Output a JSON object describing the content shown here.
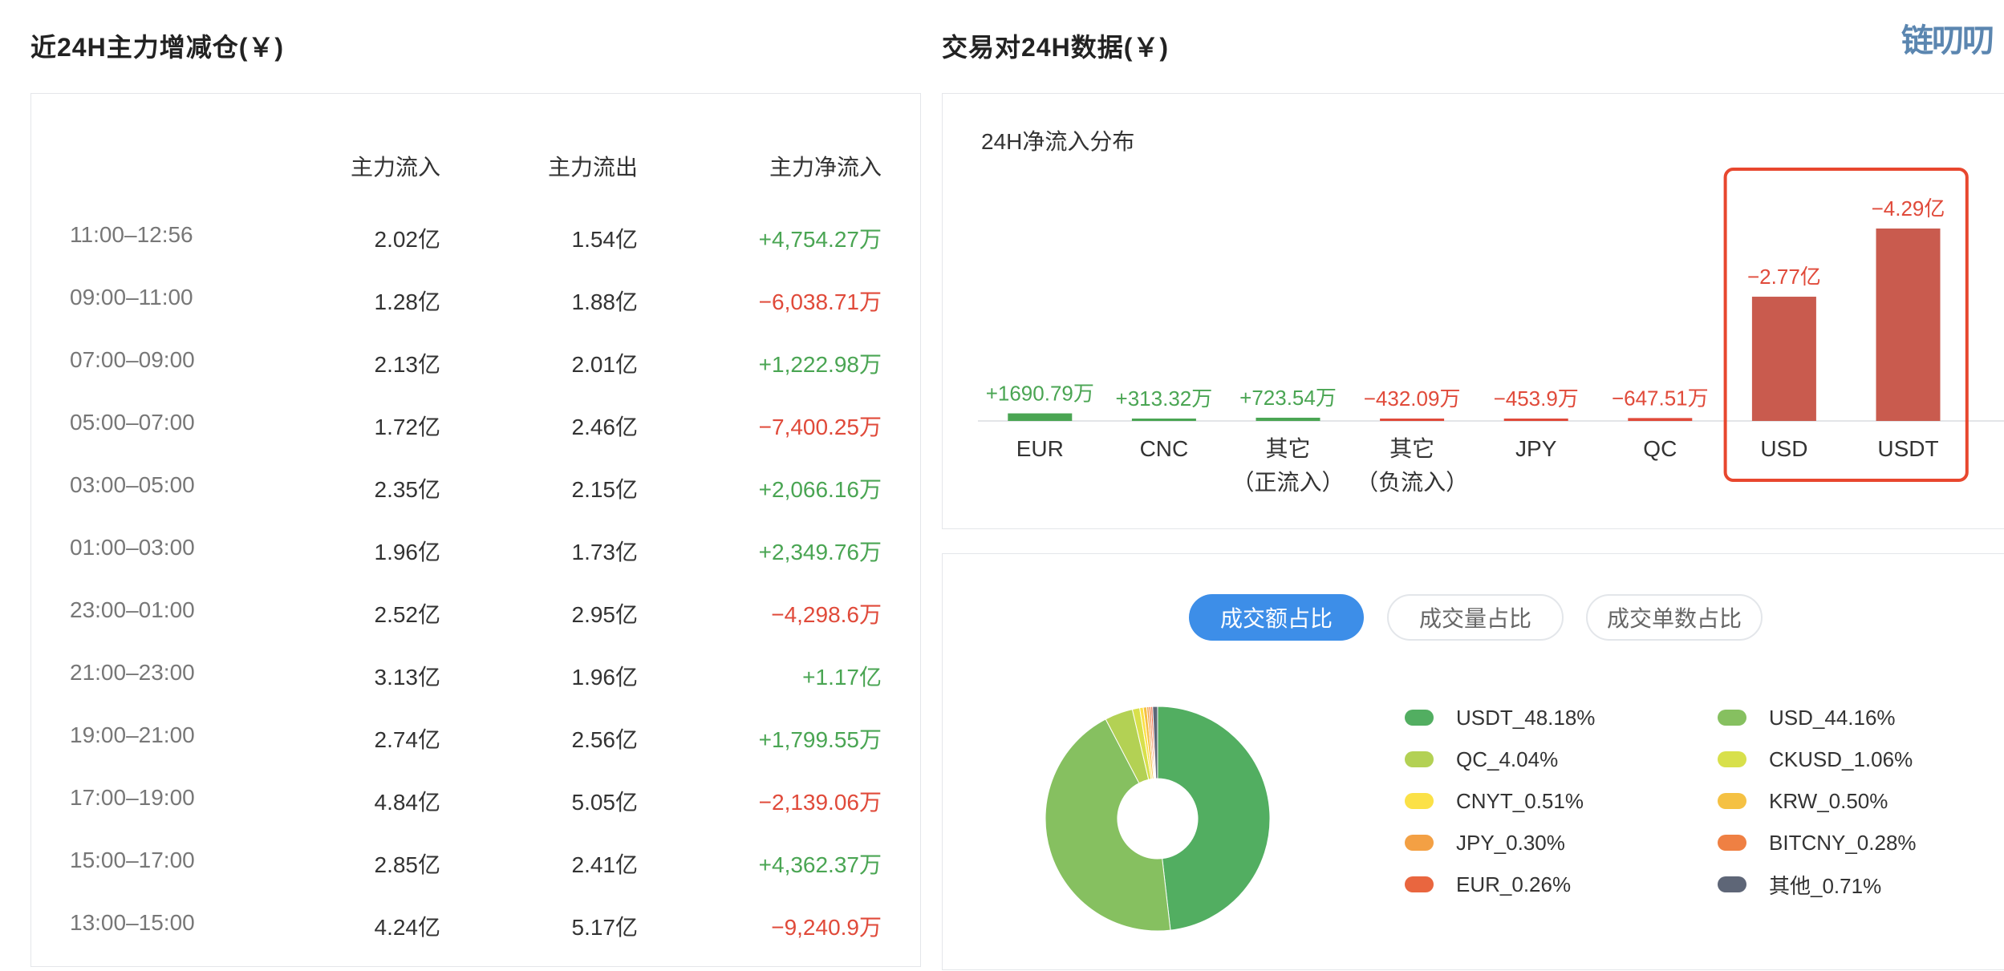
{
  "left": {
    "title": "近24H主力增减仓(￥)",
    "headers": {
      "inflow": "主力流入",
      "outflow": "主力流出",
      "net": "主力净流入"
    },
    "rows": [
      {
        "time": "11:00–12:56",
        "in": "2.02亿",
        "out": "1.54亿",
        "net": "+4,754.27万",
        "sign": "pos"
      },
      {
        "time": "09:00–11:00",
        "in": "1.28亿",
        "out": "1.88亿",
        "net": "−6,038.71万",
        "sign": "neg"
      },
      {
        "time": "07:00–09:00",
        "in": "2.13亿",
        "out": "2.01亿",
        "net": "+1,222.98万",
        "sign": "pos"
      },
      {
        "time": "05:00–07:00",
        "in": "1.72亿",
        "out": "2.46亿",
        "net": "−7,400.25万",
        "sign": "neg"
      },
      {
        "time": "03:00–05:00",
        "in": "2.35亿",
        "out": "2.15亿",
        "net": "+2,066.16万",
        "sign": "pos"
      },
      {
        "time": "01:00–03:00",
        "in": "1.96亿",
        "out": "1.73亿",
        "net": "+2,349.76万",
        "sign": "pos"
      },
      {
        "time": "23:00–01:00",
        "in": "2.52亿",
        "out": "2.95亿",
        "net": "−4,298.6万",
        "sign": "neg"
      },
      {
        "time": "21:00–23:00",
        "in": "3.13亿",
        "out": "1.96亿",
        "net": "+1.17亿",
        "sign": "pos"
      },
      {
        "time": "19:00–21:00",
        "in": "2.74亿",
        "out": "2.56亿",
        "net": "+1,799.55万",
        "sign": "pos"
      },
      {
        "time": "17:00–19:00",
        "in": "4.84亿",
        "out": "5.05亿",
        "net": "−2,139.06万",
        "sign": "neg"
      },
      {
        "time": "15:00–17:00",
        "in": "2.85亿",
        "out": "2.41亿",
        "net": "+4,362.37万",
        "sign": "pos"
      },
      {
        "time": "13:00–15:00",
        "in": "4.24亿",
        "out": "5.17亿",
        "net": "−9,240.9万",
        "sign": "neg"
      }
    ]
  },
  "right": {
    "title": "交易对24H数据(￥)",
    "logo_text": "链叨叨",
    "bar_chart_title": "24H净流入分布",
    "tabs": [
      {
        "label": "成交额占比",
        "active": true
      },
      {
        "label": "成交量占比",
        "active": false
      },
      {
        "label": "成交单数占比",
        "active": false
      }
    ]
  },
  "colors": {
    "positive": "#4aa553",
    "negative": "#e04a3a",
    "bar_negative": "#c95b4e",
    "highlight": "#e8472e",
    "tab_active": "#3d8ee8"
  },
  "chart_data": [
    {
      "type": "bar",
      "title": "24H净流入分布",
      "categories": [
        "EUR",
        "CNC",
        "其它（正流入）",
        "其它（负流入）",
        "JPY",
        "QC",
        "USD",
        "USDT"
      ],
      "category_lines": [
        [
          "EUR"
        ],
        [
          "CNC"
        ],
        [
          "其它",
          "（正流入）"
        ],
        [
          "其它",
          "（负流入）"
        ],
        [
          "JPY"
        ],
        [
          "QC"
        ],
        [
          "USD"
        ],
        [
          "USDT"
        ]
      ],
      "values_wan": [
        1690.79,
        313.32,
        723.54,
        -432.09,
        -453.9,
        -647.51,
        -27700,
        -42900
      ],
      "value_labels": [
        "+1690.79万",
        "+313.32万",
        "+723.54万",
        "−432.09万",
        "−453.9万",
        "−647.51万",
        "−2.77亿",
        "−4.29亿"
      ],
      "highlighted": [
        "USD",
        "USDT"
      ]
    },
    {
      "type": "pie",
      "donut": true,
      "slices": [
        {
          "label": "USDT_48.18%",
          "value": 48.18,
          "color": "#52ae61"
        },
        {
          "label": "USD_44.16%",
          "value": 44.16,
          "color": "#86c060"
        },
        {
          "label": "QC_4.04%",
          "value": 4.04,
          "color": "#b3d154"
        },
        {
          "label": "CKUSD_1.06%",
          "value": 1.06,
          "color": "#d8e04b"
        },
        {
          "label": "CNYT_0.51%",
          "value": 0.51,
          "color": "#fbe147"
        },
        {
          "label": "KRW_0.50%",
          "value": 0.5,
          "color": "#f5c143"
        },
        {
          "label": "JPY_0.30%",
          "value": 0.3,
          "color": "#f3a044"
        },
        {
          "label": "BITCNY_0.28%",
          "value": 0.28,
          "color": "#ef8043"
        },
        {
          "label": "EUR_0.26%",
          "value": 0.26,
          "color": "#e9663f"
        },
        {
          "label": "其他_0.71%",
          "value": 0.71,
          "color": "#5e6677"
        }
      ]
    }
  ]
}
